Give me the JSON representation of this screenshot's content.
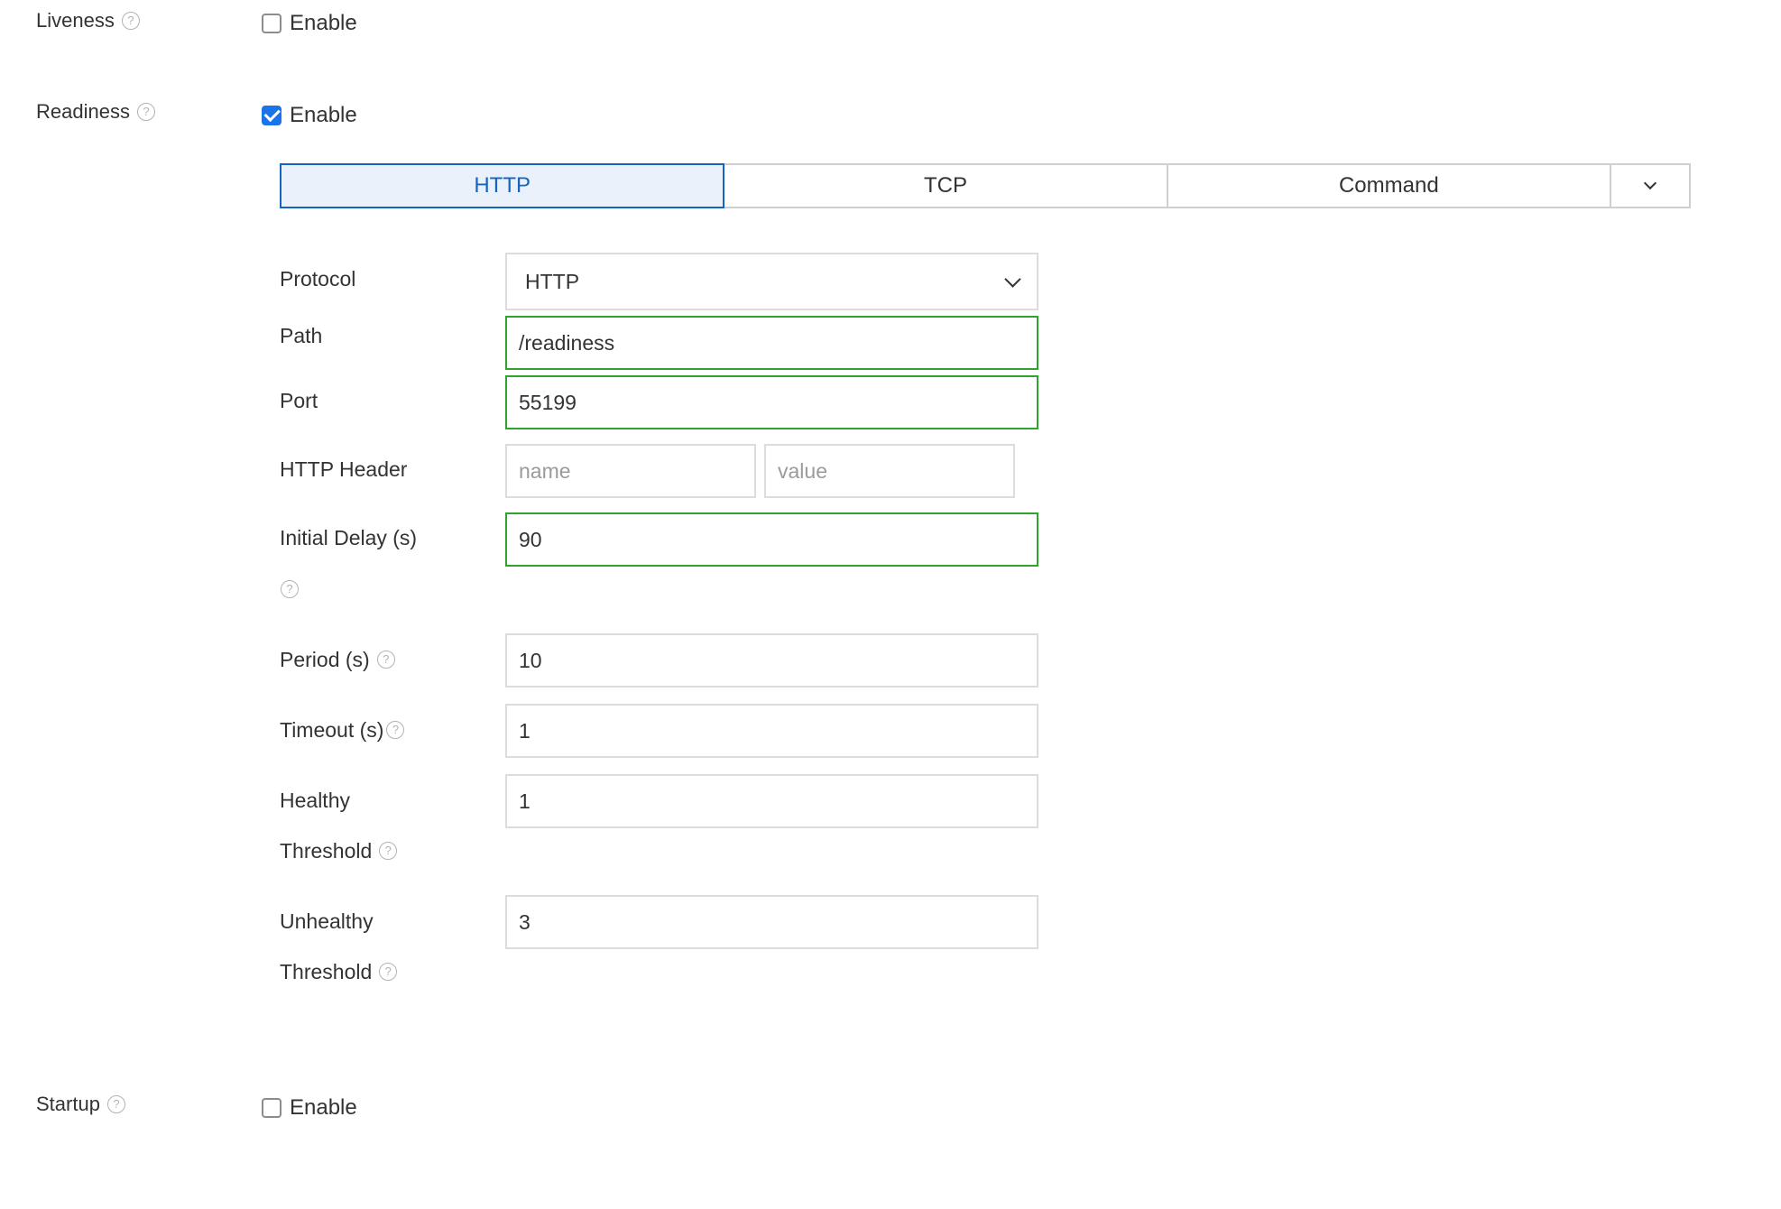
{
  "liveness": {
    "label": "Liveness",
    "enable_label": "Enable",
    "enabled": false
  },
  "readiness": {
    "label": "Readiness",
    "enable_label": "Enable",
    "enabled": true,
    "tabs": [
      "HTTP",
      "TCP",
      "Command"
    ],
    "active_tab": "HTTP",
    "form": {
      "protocol": {
        "label": "Protocol",
        "value": "HTTP"
      },
      "path": {
        "label": "Path",
        "value": "/readiness"
      },
      "port": {
        "label": "Port",
        "value": "55199"
      },
      "http_header": {
        "label": "HTTP Header",
        "name_placeholder": "name",
        "value_placeholder": "value"
      },
      "initial_delay": {
        "label": "Initial Delay (s)",
        "value": "90"
      },
      "period": {
        "label": "Period (s)",
        "value": "10"
      },
      "timeout": {
        "label": "Timeout (s)",
        "value": "1"
      },
      "healthy_threshold": {
        "label_line1": "Healthy",
        "label_line2": "Threshold",
        "value": "1"
      },
      "unhealthy_threshold": {
        "label_line1": "Unhealthy",
        "label_line2": "Threshold",
        "value": "3"
      }
    }
  },
  "startup": {
    "label": "Startup",
    "enable_label": "Enable",
    "enabled": false
  },
  "colors": {
    "accent": "#1a73e8",
    "tab_active_text": "#1565c0",
    "tab_active_bg": "#eaf1fb",
    "valid_border": "#2ea32e"
  },
  "icons": {
    "help": "help-circle-icon",
    "chevron": "chevron-down-icon",
    "check": "check-icon"
  }
}
